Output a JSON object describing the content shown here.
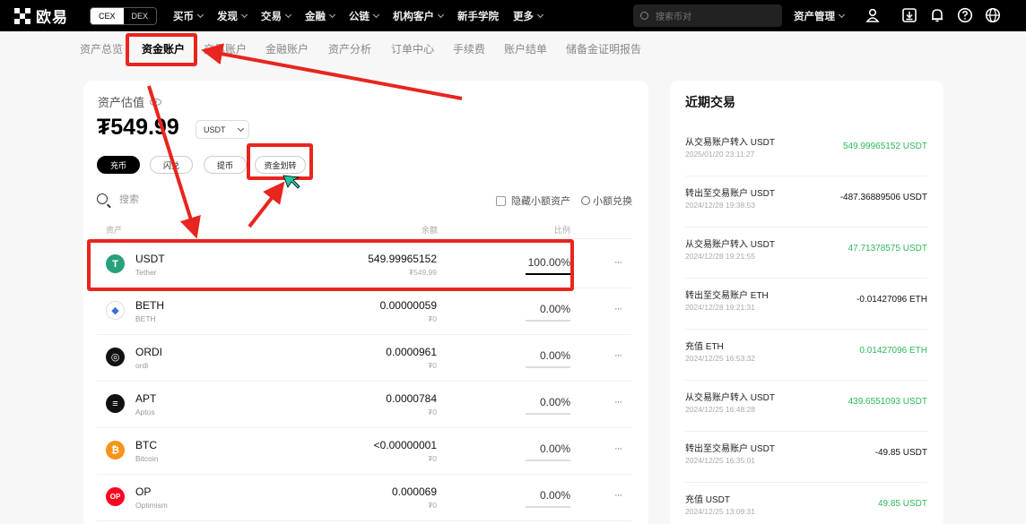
{
  "topbar": {
    "logo_text": "欧易",
    "switch": [
      "CEX",
      "DEX"
    ],
    "nav": [
      {
        "label": "买币",
        "dropdown": true
      },
      {
        "label": "发现",
        "dropdown": true
      },
      {
        "label": "交易",
        "dropdown": true
      },
      {
        "label": "金融",
        "dropdown": true
      },
      {
        "label": "公链",
        "dropdown": true
      },
      {
        "label": "机构客户",
        "dropdown": true
      },
      {
        "label": "新手学院",
        "dropdown": false
      },
      {
        "label": "更多",
        "dropdown": true
      }
    ],
    "search_placeholder": "搜索币对",
    "asset_mgmt": "资产管理",
    "icons": [
      "user-icon",
      "download-icon",
      "bell-icon",
      "help-icon",
      "globe-icon"
    ]
  },
  "subnav": {
    "items": [
      "资产总览",
      "资金账户",
      "交易账户",
      "金融账户",
      "资产分析",
      "订单中心",
      "手续费",
      "账户结单",
      "储备金证明报告"
    ],
    "active": "资金账户"
  },
  "overview": {
    "estimate_label": "资产估值",
    "balance": "₮549.99",
    "unit": "USDT",
    "buttons": {
      "deposit": "充币",
      "flash": "闪兑",
      "withdraw": "提币",
      "transfer": "资金划转"
    },
    "search_placeholder": "搜索",
    "hide_small": "隐藏小额资产",
    "swap_small": "小额兑换"
  },
  "table": {
    "headers": {
      "asset": "资产",
      "balance": "余额",
      "ratio": "比例"
    },
    "rows": [
      {
        "symbol": "USDT",
        "name": "Tether",
        "balance": "549.99965152",
        "fiat": "₮549.99",
        "pct": "100.00%",
        "pct_value": 100,
        "icon": "tether-icon",
        "color": "#26a17b",
        "glyph": "T"
      },
      {
        "symbol": "BETH",
        "name": "BETH",
        "balance": "0.00000059",
        "fiat": "₮0",
        "pct": "0.00%",
        "pct_value": 0,
        "icon": "eth-icon",
        "color": "#ffffff",
        "glyph": "◆"
      },
      {
        "symbol": "ORDI",
        "name": "ordi",
        "balance": "0.0000961",
        "fiat": "₮0",
        "pct": "0.00%",
        "pct_value": 0,
        "icon": "ordi-icon",
        "color": "#111111",
        "glyph": "◎"
      },
      {
        "symbol": "APT",
        "name": "Aptos",
        "balance": "0.0000784",
        "fiat": "₮0",
        "pct": "0.00%",
        "pct_value": 0,
        "icon": "aptos-icon",
        "color": "#111111",
        "glyph": "≡"
      },
      {
        "symbol": "BTC",
        "name": "Bitcoin",
        "balance": "<0.00000001",
        "fiat": "₮0",
        "pct": "0.00%",
        "pct_value": 0,
        "icon": "bitcoin-icon",
        "color": "#f7931a",
        "glyph": "₿"
      },
      {
        "symbol": "OP",
        "name": "Optimism",
        "balance": "0.000069",
        "fiat": "₮0",
        "pct": "0.00%",
        "pct_value": 0,
        "icon": "optimism-icon",
        "color": "#ff0420",
        "glyph": "OP"
      }
    ]
  },
  "recent": {
    "title": "近期交易",
    "items": [
      {
        "title": "从交易账户转入 USDT",
        "time": "2025/01/20 23:11:27",
        "amount": "549.99965152 USDT",
        "positive": true
      },
      {
        "title": "转出至交易账户 USDT",
        "time": "2024/12/28 19:38:53",
        "amount": "-487.36889506 USDT",
        "positive": false
      },
      {
        "title": "从交易账户转入 USDT",
        "time": "2024/12/28 19:21:55",
        "amount": "47.71378575 USDT",
        "positive": true
      },
      {
        "title": "转出至交易账户 ETH",
        "time": "2024/12/28 19:21:31",
        "amount": "-0.01427096 ETH",
        "positive": false
      },
      {
        "title": "充值 ETH",
        "time": "2024/12/25 16:53:32",
        "amount": "0.01427096 ETH",
        "positive": true
      },
      {
        "title": "从交易账户转入 USDT",
        "time": "2024/12/25 16:48:28",
        "amount": "439.6551093 USDT",
        "positive": true
      },
      {
        "title": "转出至交易账户 USDT",
        "time": "2024/12/25 16:35:01",
        "amount": "-49.85 USDT",
        "positive": false
      },
      {
        "title": "充值 USDT",
        "time": "2024/12/25 13:09:31",
        "amount": "49.85 USDT",
        "positive": true
      }
    ]
  },
  "colors": {
    "positive": "#2fb85b",
    "negative": "#111111",
    "annotation": "#e8251f"
  }
}
